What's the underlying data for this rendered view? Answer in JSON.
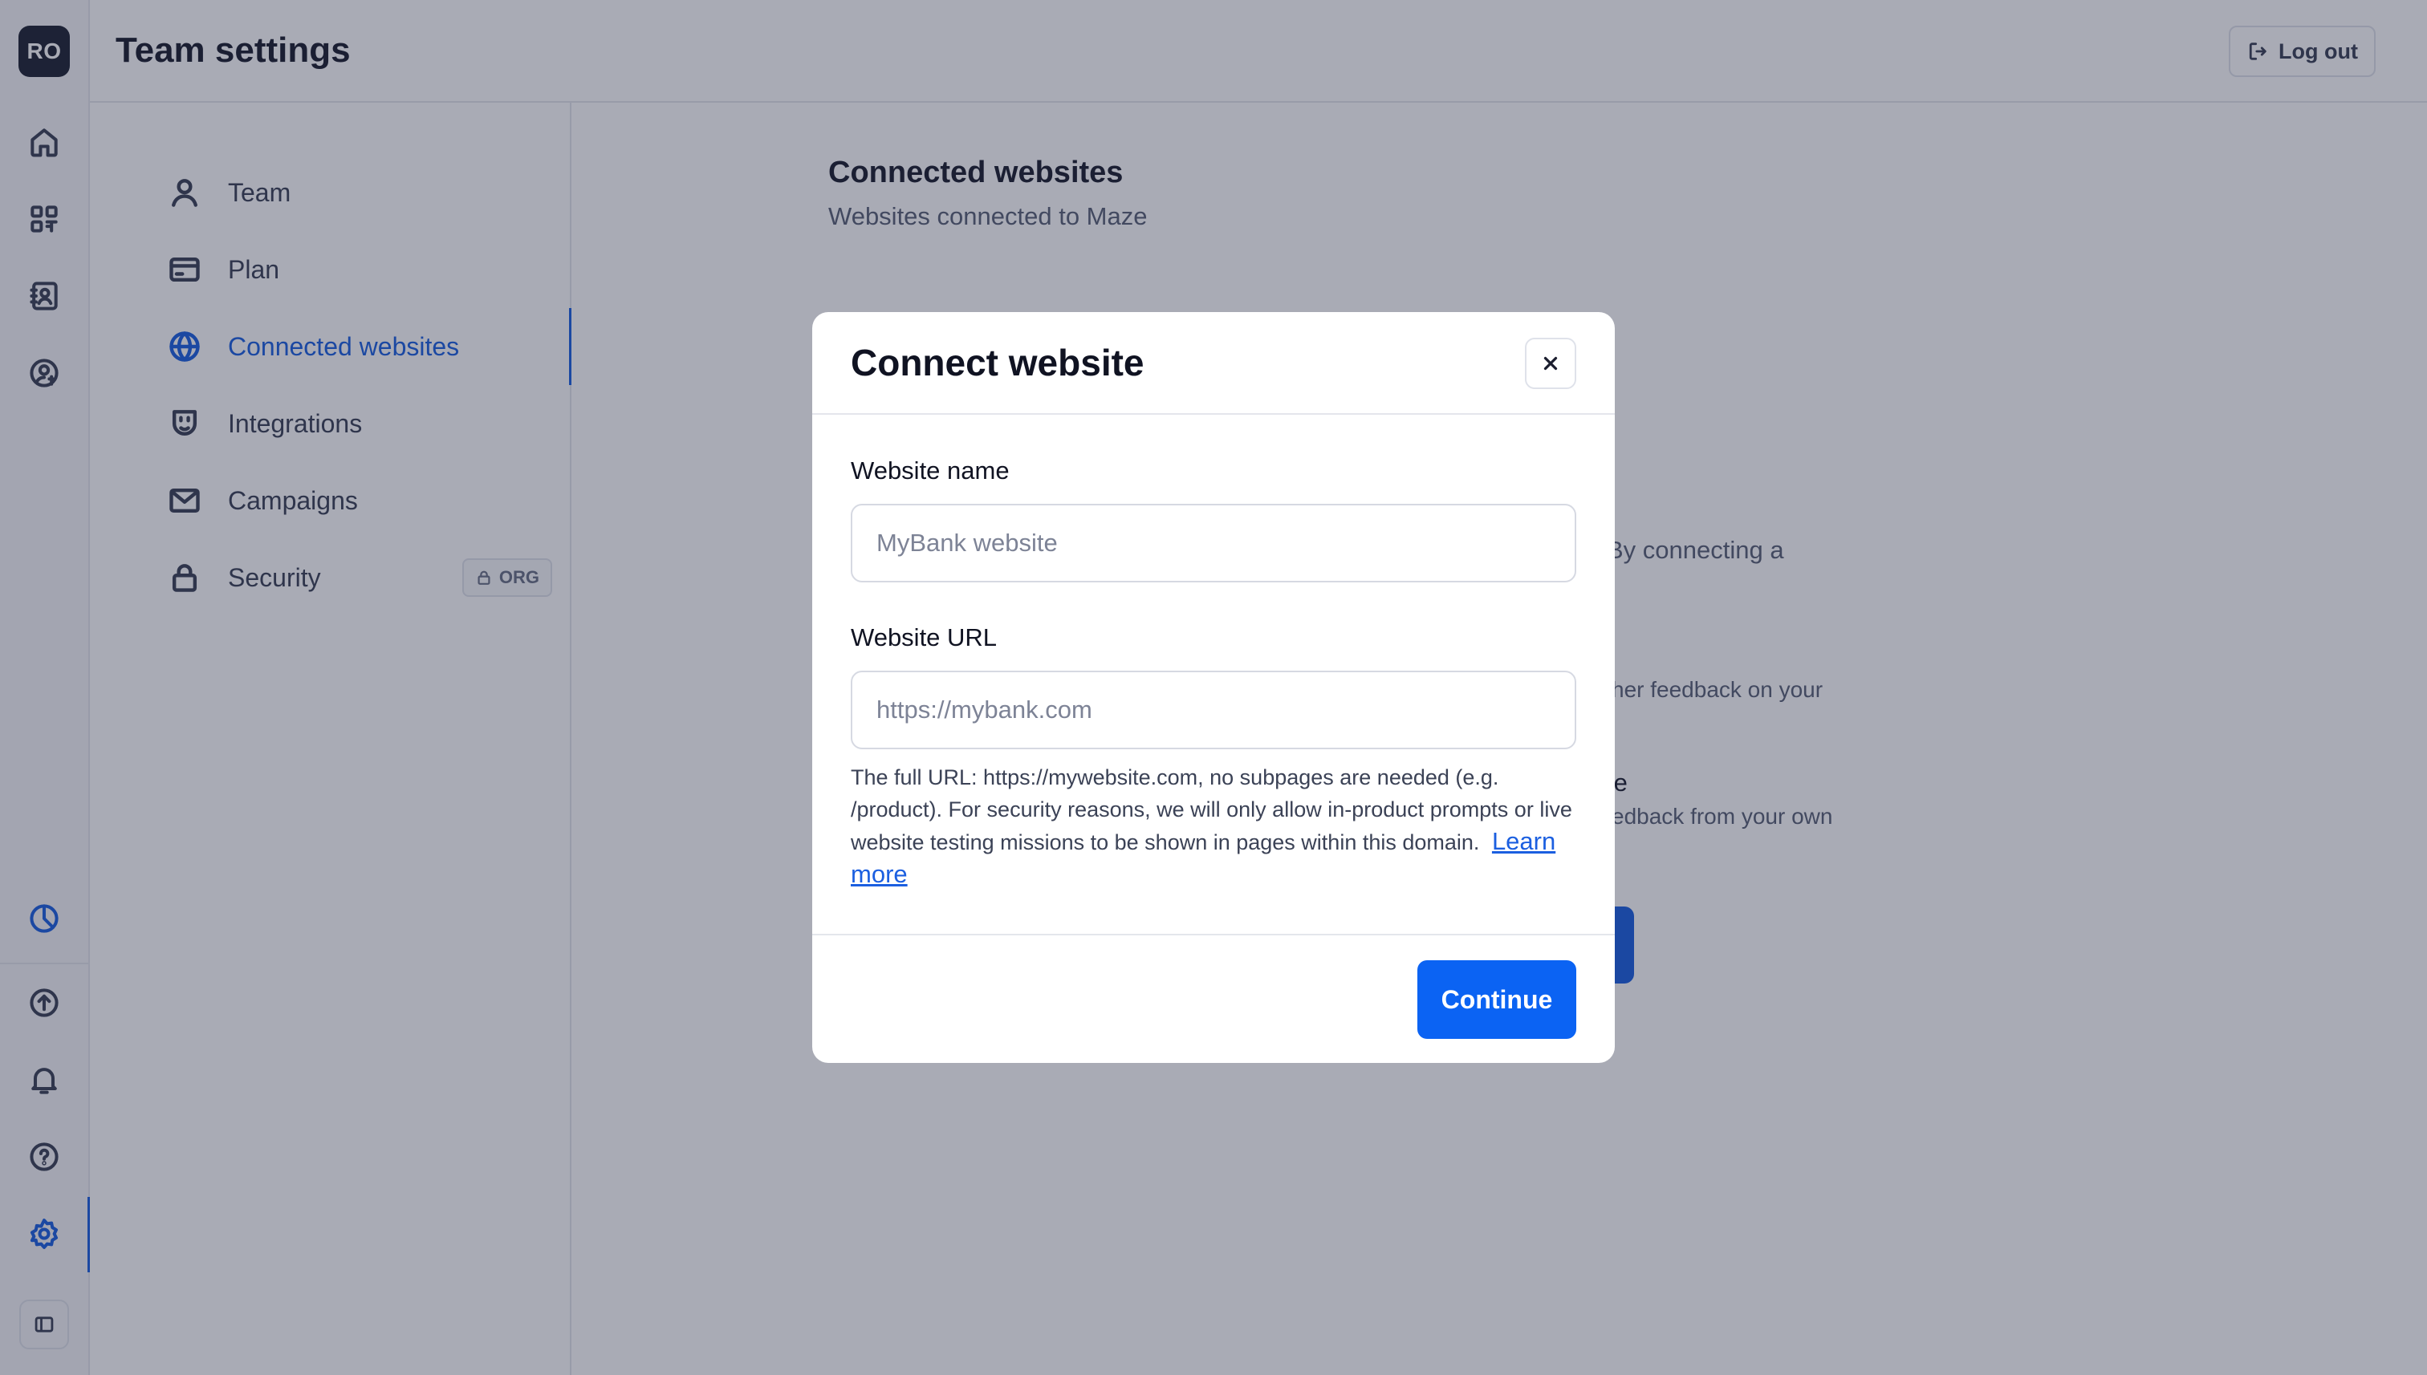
{
  "user": {
    "initials": "RO"
  },
  "header": {
    "title": "Team settings",
    "logout_label": "Log out"
  },
  "rail": {
    "icons": [
      "home-icon",
      "grid-icon",
      "contacts-icon",
      "user-dollar-icon",
      "chart-icon",
      "upload-icon",
      "bell-icon",
      "help-icon",
      "gear-icon",
      "sidebar-toggle-icon"
    ]
  },
  "settings_nav": {
    "items": [
      {
        "label": "Team",
        "icon": "user-icon"
      },
      {
        "label": "Plan",
        "icon": "card-icon"
      },
      {
        "label": "Connected websites",
        "icon": "globe-icon",
        "active": true
      },
      {
        "label": "Integrations",
        "icon": "plug-icon"
      },
      {
        "label": "Campaigns",
        "icon": "mail-icon"
      },
      {
        "label": "Security",
        "icon": "lock-icon",
        "badge": "ORG"
      }
    ]
  },
  "main": {
    "title": "Connected websites",
    "subtitle": "Websites connected to Maze",
    "partial_texts": [
      "By connecting a",
      "her feedback on your",
      "te",
      "edback from your own"
    ]
  },
  "modal": {
    "title": "Connect website",
    "name_label": "Website name",
    "name_placeholder": "MyBank website",
    "url_label": "Website URL",
    "url_placeholder": "https://mybank.com",
    "help_text": "The full URL: https://mywebsite.com, no subpages are needed (e.g. /product). For security reasons, we will only allow in-product prompts or live website testing missions to be shown in pages within this domain.",
    "learn_more": "Learn more",
    "continue_label": "Continue"
  },
  "colors": {
    "accent": "#1b5fe0",
    "primary_button": "#0b63f3",
    "overlay": "rgba(28,33,60,0.38)",
    "avatar_bg": "#1d2232"
  }
}
